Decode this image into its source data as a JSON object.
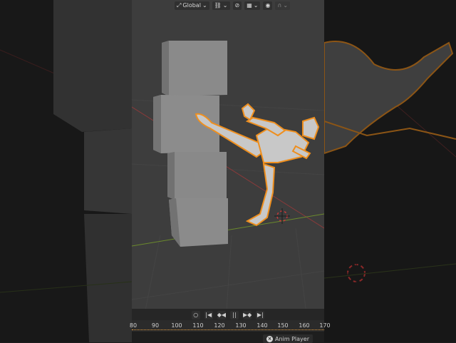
{
  "header": {
    "orientation_label": "Global",
    "orientation_icon": "transform-orientation-icon",
    "pivot_icon": "link-icon",
    "snap_icon": "snap-icon",
    "snap_target_icon": "snap-target-icon",
    "proportional_icon": "proportional-edit-icon",
    "falloff_icon": "falloff-curve-icon"
  },
  "timeline": {
    "controls": [
      {
        "name": "record-button",
        "glyph": "○"
      },
      {
        "name": "jump-start-button",
        "glyph": "|◀"
      },
      {
        "name": "prev-keyframe-button",
        "glyph": "◆◀"
      },
      {
        "name": "pause-button",
        "glyph": "||"
      },
      {
        "name": "next-keyframe-button",
        "glyph": "▶◆"
      },
      {
        "name": "jump-end-button",
        "glyph": "▶|"
      }
    ],
    "ruler": [
      "80",
      "90",
      "100",
      "110",
      "120",
      "130",
      "140",
      "150",
      "160",
      "170"
    ],
    "accent_color": "#e29a3c"
  },
  "footer": {
    "anim_player_label": "Anim Player"
  },
  "colors": {
    "selection_outline": "#ef8f1e",
    "viewport_bg": "#3d3d3d",
    "x_axis": "#8b3a3a",
    "y_axis": "#6b8a2c"
  }
}
